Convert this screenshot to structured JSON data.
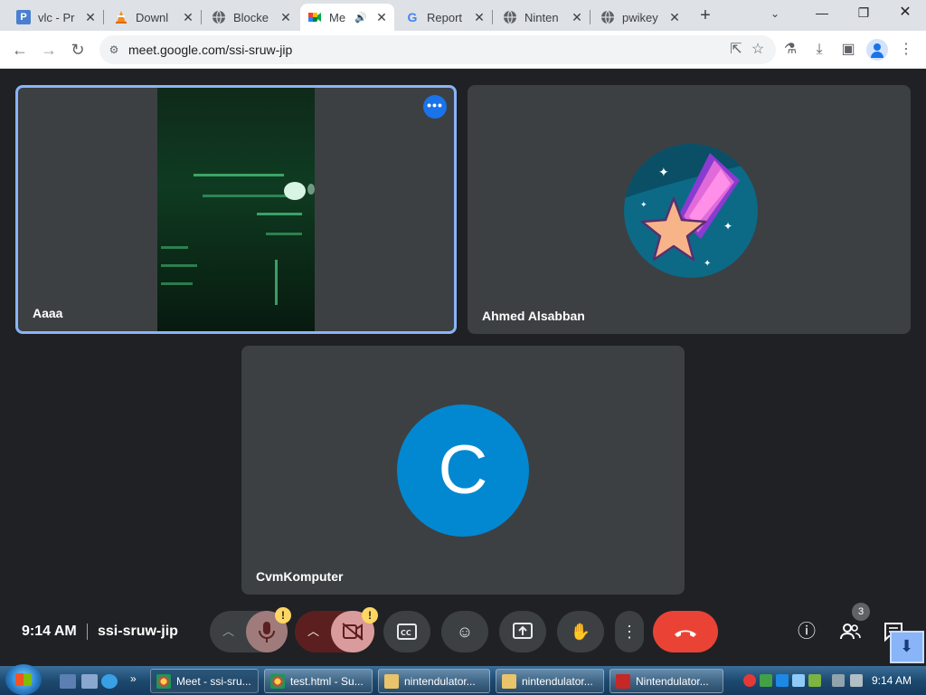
{
  "browser": {
    "tabs": [
      {
        "title": "vlc - Pr",
        "icon": "vlc-icon"
      },
      {
        "title": "Downl",
        "icon": "vlc-cone-icon"
      },
      {
        "title": "Blocke",
        "icon": "globe-icon"
      },
      {
        "title": "Me",
        "icon": "google-meet-icon",
        "active": true,
        "audio": true
      },
      {
        "title": "Report",
        "icon": "google-icon"
      },
      {
        "title": "Ninten",
        "icon": "globe-icon"
      },
      {
        "title": "pwikey",
        "icon": "globe-icon"
      }
    ],
    "address": "meet.google.com/ssi-sruw-jip"
  },
  "meeting": {
    "participants": [
      {
        "name": "Aaaa",
        "type": "video"
      },
      {
        "name": "Ahmed Alsabban",
        "type": "avatar-image"
      },
      {
        "name": "CvmKomputer",
        "type": "avatar-letter",
        "letter": "C",
        "color": "#0288d1"
      }
    ],
    "time": "9:14 AM",
    "code": "ssi-sruw-jip",
    "people_count": "3",
    "warning_mark": "!"
  },
  "taskbar": {
    "tasks": [
      {
        "label": "Meet - ssi-sru...",
        "active": true
      },
      {
        "label": "test.html - Su..."
      },
      {
        "label": "nintendulator..."
      },
      {
        "label": "nintendulator..."
      },
      {
        "label": "Nintendulator..."
      }
    ],
    "clock": "9:14 AM"
  },
  "colors": {
    "accent": "#1a73e8",
    "selected_tile_border": "#8ab4f8",
    "end_call": "#ea4335",
    "muted_red": "#5c1f1f",
    "warning": "#fdd663"
  }
}
